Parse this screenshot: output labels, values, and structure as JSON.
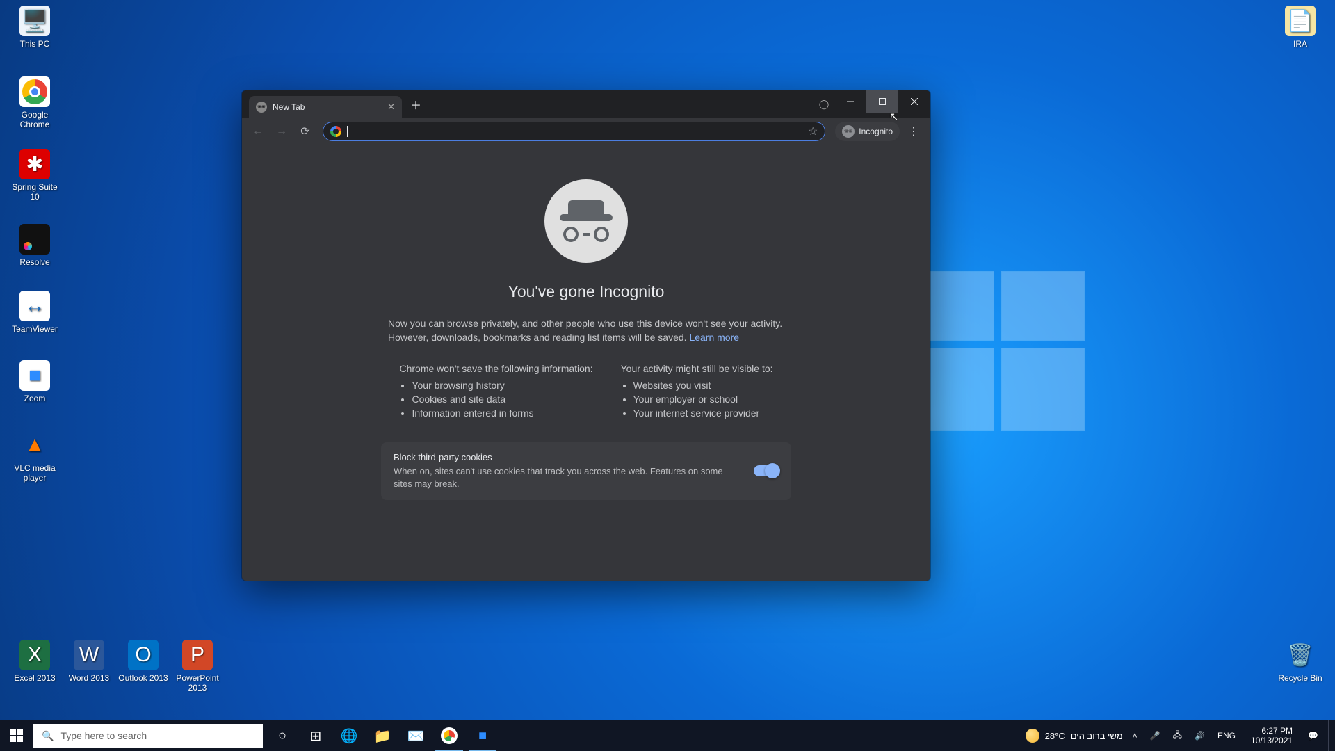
{
  "desktop_icons": {
    "this_pc": "This PC",
    "chrome": "Google Chrome",
    "spring": "Spring Suite 10",
    "resolve": "Resolve",
    "teamviewer": "TeamViewer",
    "zoom": "Zoom",
    "vlc": "VLC media player",
    "excel": "Excel 2013",
    "word": "Word 2013",
    "outlook": "Outlook 2013",
    "powerpoint": "PowerPoint 2013",
    "recycle": "Recycle Bin",
    "ira": "IRA"
  },
  "chrome": {
    "tab_title": "New Tab",
    "incognito_chip": "Incognito",
    "omnibox_value": "",
    "page": {
      "heading": "You've gone Incognito",
      "intro": "Now you can browse privately, and other people who use this device won't see your activity. However, downloads, bookmarks and reading list items will be saved. ",
      "learn_more": "Learn more",
      "col1_heading": "Chrome won't save the following information:",
      "col1_items": [
        "Your browsing history",
        "Cookies and site data",
        "Information entered in forms"
      ],
      "col2_heading": "Your activity might still be visible to:",
      "col2_items": [
        "Websites you visit",
        "Your employer or school",
        "Your internet service provider"
      ],
      "cookies_title": "Block third-party cookies",
      "cookies_desc": "When on, sites can't use cookies that track you across the web. Features on some sites may break."
    }
  },
  "taskbar": {
    "search_placeholder": "Type here to search",
    "weather_temp": "28°C",
    "weather_text": "משי ברוב הים",
    "lang": "ENG",
    "time": "6:27 PM",
    "date": "10/13/2021"
  }
}
